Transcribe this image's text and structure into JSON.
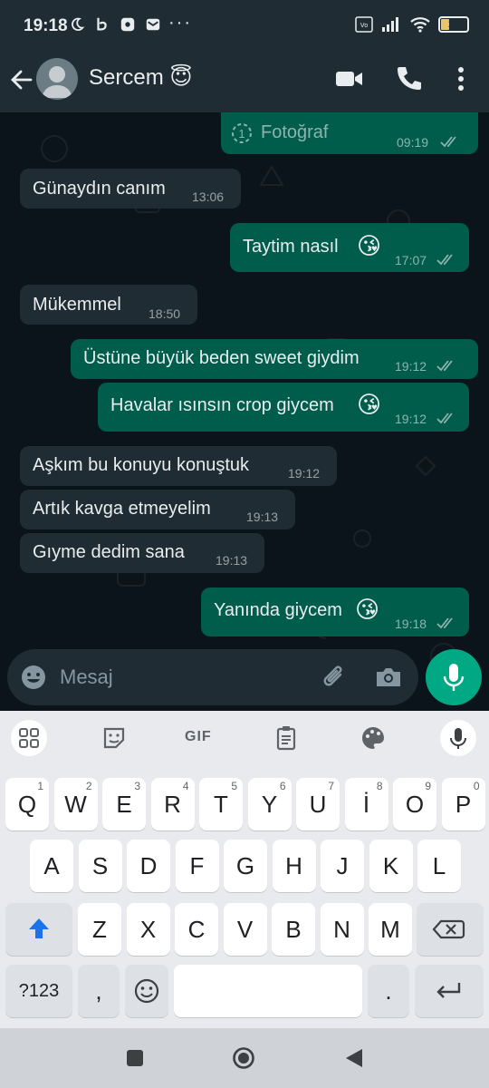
{
  "status_bar": {
    "time": "19:18",
    "battery": "19",
    "more": "···"
  },
  "header": {
    "contact_name": "Sercem",
    "contact_emoji": "😇"
  },
  "messages": [
    {
      "dir": "out",
      "text": "Fotoğraf",
      "time": "09:19",
      "type": "photo"
    },
    {
      "dir": "in",
      "text": "Günaydın canım",
      "time": "13:06"
    },
    {
      "dir": "out",
      "text": "Taytim nasıl",
      "time": "17:07",
      "emoji": "😘"
    },
    {
      "dir": "in",
      "text": "Mükemmel",
      "time": "18:50"
    },
    {
      "dir": "out",
      "text": "Üstüne büyük beden sweet giydim",
      "time": "19:12"
    },
    {
      "dir": "out",
      "text": "Havalar ısınsın crop giycem",
      "time": "19:12",
      "emoji": "😘"
    },
    {
      "dir": "in",
      "text": "Aşkım bu konuyu konuştuk",
      "time": "19:12"
    },
    {
      "dir": "in",
      "text": "Artık kavga etmeyelim",
      "time": "19:13"
    },
    {
      "dir": "in",
      "text": "Gıyme dedim sana",
      "time": "19:13"
    },
    {
      "dir": "out",
      "text": "Yanında giycem",
      "time": "19:18",
      "emoji": "😘"
    }
  ],
  "composer": {
    "placeholder": "Mesaj"
  },
  "keyboard": {
    "gif_label": "GIF",
    "row1": [
      {
        "k": "Q",
        "s": "1"
      },
      {
        "k": "W",
        "s": "2"
      },
      {
        "k": "E",
        "s": "3"
      },
      {
        "k": "R",
        "s": "4"
      },
      {
        "k": "T",
        "s": "5"
      },
      {
        "k": "Y",
        "s": "6"
      },
      {
        "k": "U",
        "s": "7"
      },
      {
        "k": "İ",
        "s": "8"
      },
      {
        "k": "O",
        "s": "9"
      },
      {
        "k": "P",
        "s": "0"
      }
    ],
    "row2": [
      "A",
      "S",
      "D",
      "F",
      "G",
      "H",
      "J",
      "K",
      "L"
    ],
    "row3": [
      "Z",
      "X",
      "C",
      "V",
      "B",
      "N",
      "M"
    ],
    "symbols_label": "?123",
    "comma": ",",
    "period": "."
  },
  "colors": {
    "incoming": "#1f2c34",
    "outgoing": "#005c4b",
    "accent": "#00a884",
    "header": "#1f2c34"
  }
}
